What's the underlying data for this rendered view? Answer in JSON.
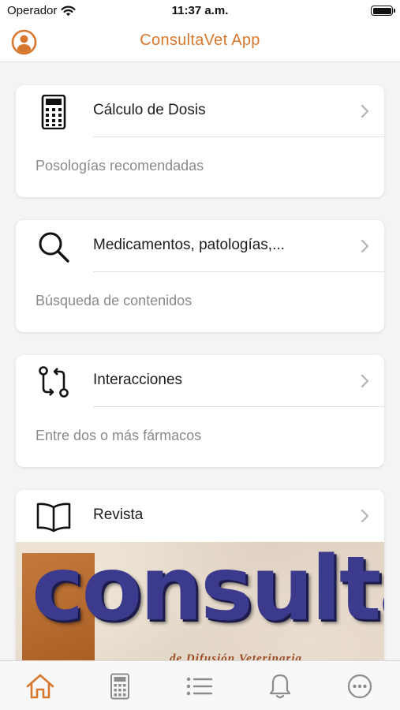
{
  "status_bar": {
    "carrier": "Operador",
    "time": "11:37 a.m."
  },
  "header": {
    "title": "ConsultaVet App",
    "avatar_icon": "user-circle-icon"
  },
  "colors": {
    "accent": "#d8782e",
    "tab_inactive": "#8c8c8c",
    "cover_text": "#3c3a8c"
  },
  "cards": [
    {
      "title": "Cálculo de Dosis",
      "subtitle": "Posologías recomendadas",
      "icon": "calculator-icon"
    },
    {
      "title": "Medicamentos, patologías,...",
      "subtitle": "Búsqueda de contenidos",
      "icon": "search-icon"
    },
    {
      "title": "Interacciones",
      "subtitle": "Entre dos o más fármacos",
      "icon": "interactions-icon"
    },
    {
      "title": "Revista",
      "icon": "book-icon"
    }
  ],
  "magazine_cover": {
    "title": "consulta",
    "subtitle": "de Difusión Veterinaria"
  },
  "tabs": [
    {
      "name": "home",
      "icon": "home-icon",
      "active": true
    },
    {
      "name": "calculator",
      "icon": "calculator-icon",
      "active": false
    },
    {
      "name": "list",
      "icon": "list-icon",
      "active": false
    },
    {
      "name": "notifications",
      "icon": "bell-icon",
      "active": false
    },
    {
      "name": "more",
      "icon": "more-icon",
      "active": false
    }
  ]
}
